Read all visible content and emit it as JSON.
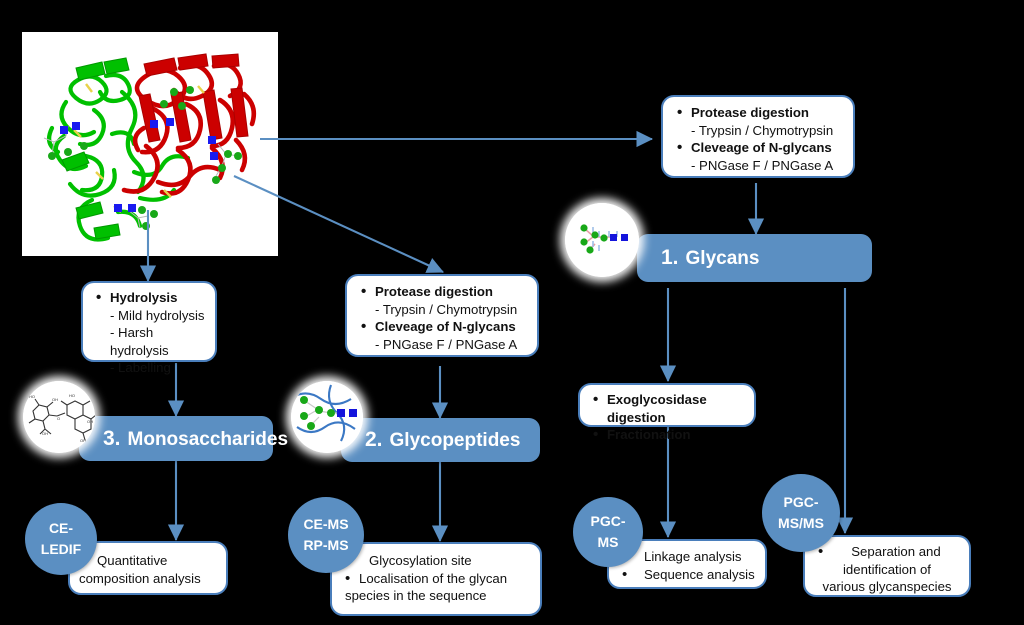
{
  "figure": {
    "protein_image": {
      "name": "glycoprotein-ribbon-structure",
      "domains": [
        "green-chain",
        "red-chain"
      ],
      "glycan_symbols": [
        "green-circle-mannose",
        "blue-square-glcnac"
      ]
    }
  },
  "boxes": {
    "protease_top": {
      "lines": [
        {
          "text": "Protease digestion",
          "style": "bullet-bold"
        },
        {
          "text": "- Trypsin / Chymotrypsin",
          "style": "sub"
        },
        {
          "text": "Cleveage of N-glycans",
          "style": "bullet-bold"
        },
        {
          "text": "- PNGase F / PNGase A",
          "style": "sub"
        }
      ]
    },
    "protease_mid": {
      "lines": [
        {
          "text": "Protease digestion",
          "style": "bullet-bold"
        },
        {
          "text": "- Trypsin / Chymotrypsin",
          "style": "sub"
        },
        {
          "text": "Cleveage of N-glycans",
          "style": "bullet-bold"
        },
        {
          "text": "- PNGase F / PNGase A",
          "style": "sub"
        }
      ]
    },
    "hydrolysis": {
      "lines": [
        {
          "text": "Hydrolysis",
          "style": "bullet-bold"
        },
        {
          "text": "- Mild hydrolysis",
          "style": "sub"
        },
        {
          "text": "- Harsh hydrolysis",
          "style": "sub"
        },
        {
          "text": "- Labelling",
          "style": "sub"
        }
      ]
    },
    "exoglycosidase": {
      "lines": [
        {
          "text": "Exoglycosidase digestion",
          "style": "bullet-bold"
        },
        {
          "text": "Fractionation",
          "style": "bullet-bold"
        }
      ]
    },
    "pgc_ms_results": {
      "lines": [
        {
          "text": "Linkage analysis",
          "style": "bullet"
        },
        {
          "text": "Sequence analysis",
          "style": "bullet"
        }
      ]
    },
    "pgc_msms_results": {
      "lines": [
        {
          "text": "Separation and",
          "style": "bullet-center"
        },
        {
          "text": "identification of",
          "style": "plain-center"
        },
        {
          "text": "various glycanspecies",
          "style": "plain-center"
        }
      ]
    },
    "glycopeptide_results": {
      "lines": [
        {
          "text": "Glycosylation site",
          "style": "bullet"
        },
        {
          "text": "Localisation of the glycan",
          "style": "bullet"
        },
        {
          "text": "species in the sequence",
          "style": "plain"
        }
      ]
    },
    "monosaccharide_results": {
      "lines": [
        {
          "text": "Quantitative",
          "style": "bullet"
        },
        {
          "text": "composition analysis",
          "style": "plain"
        }
      ]
    }
  },
  "banners": [
    {
      "id": "glycans",
      "number": "1.",
      "title": "Glycans"
    },
    {
      "id": "glycopeptides",
      "number": "2.",
      "title": "Glycopeptides"
    },
    {
      "id": "monosaccharides",
      "number": "3.",
      "title": "Monosaccharides"
    }
  ],
  "tech_circles": [
    {
      "id": "ce-ledif",
      "line1": "CE-",
      "line2": "LEDIF"
    },
    {
      "id": "ce-ms-rp-ms",
      "line1": "CE-MS",
      "line2": "RP-MS"
    },
    {
      "id": "pgc-ms",
      "line1": "PGC-",
      "line2": "MS"
    },
    {
      "id": "pgc-msms",
      "line1": "PGC-",
      "line2": "MS/MS"
    }
  ],
  "icons": {
    "glycan_circle": "glycan-structure-icon",
    "glycopeptide_circle": "glycopeptide-structure-icon",
    "monosaccharide_circle": "monosaccharide-chemical-structure-icon"
  },
  "colors": {
    "accent_blue": "#5b8fc2",
    "border_blue": "#4a7ebb",
    "arrow_blue": "#5b8fc2",
    "glycan_green": "#20a020",
    "glycan_blue": "#1010d0",
    "protein_green": "#00cc00",
    "protein_red": "#cc0000",
    "background": "#000000",
    "box_fill": "#ffffff"
  }
}
